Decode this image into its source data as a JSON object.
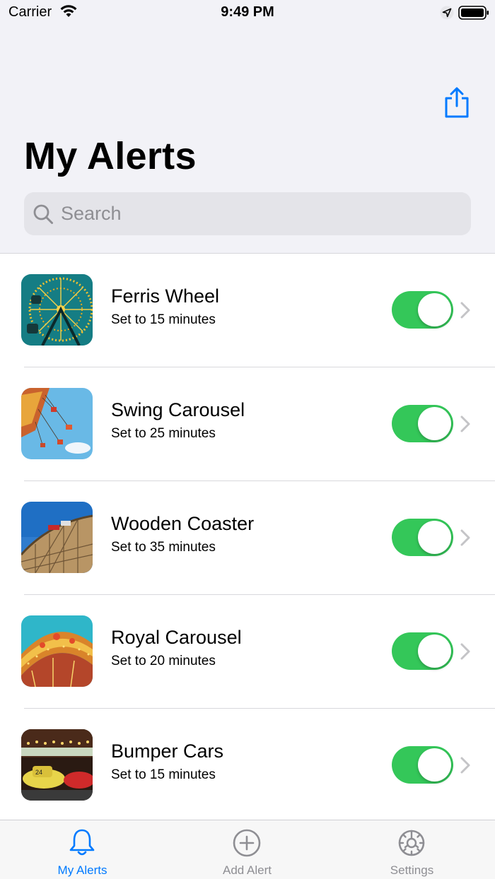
{
  "status_bar": {
    "carrier": "Carrier",
    "time": "9:49 PM"
  },
  "header": {
    "title": "My Alerts",
    "share_icon": "share-icon"
  },
  "search": {
    "placeholder": "Search",
    "value": ""
  },
  "alerts": [
    {
      "title": "Ferris Wheel",
      "subtitle": "Set to 15 minutes",
      "enabled": true,
      "thumbnail": "ferris-wheel-photo"
    },
    {
      "title": "Swing Carousel",
      "subtitle": "Set to 25 minutes",
      "enabled": true,
      "thumbnail": "swing-carousel-photo"
    },
    {
      "title": "Wooden Coaster",
      "subtitle": "Set to 35 minutes",
      "enabled": true,
      "thumbnail": "wooden-coaster-photo"
    },
    {
      "title": "Royal Carousel",
      "subtitle": "Set to 20 minutes",
      "enabled": true,
      "thumbnail": "royal-carousel-photo"
    },
    {
      "title": "Bumper Cars",
      "subtitle": "Set to 15 minutes",
      "enabled": true,
      "thumbnail": "bumper-cars-photo"
    }
  ],
  "tab_bar": {
    "tabs": [
      {
        "label": "My Alerts",
        "icon": "bell-icon",
        "selected": true
      },
      {
        "label": "Add Alert",
        "icon": "plus-circle-icon",
        "selected": false
      },
      {
        "label": "Settings",
        "icon": "gear-icon",
        "selected": false
      }
    ]
  },
  "colors": {
    "accent": "#007aff",
    "toggle_on": "#34c759",
    "tab_inactive": "#8e8e93",
    "header_bg": "#f2f2f7"
  }
}
